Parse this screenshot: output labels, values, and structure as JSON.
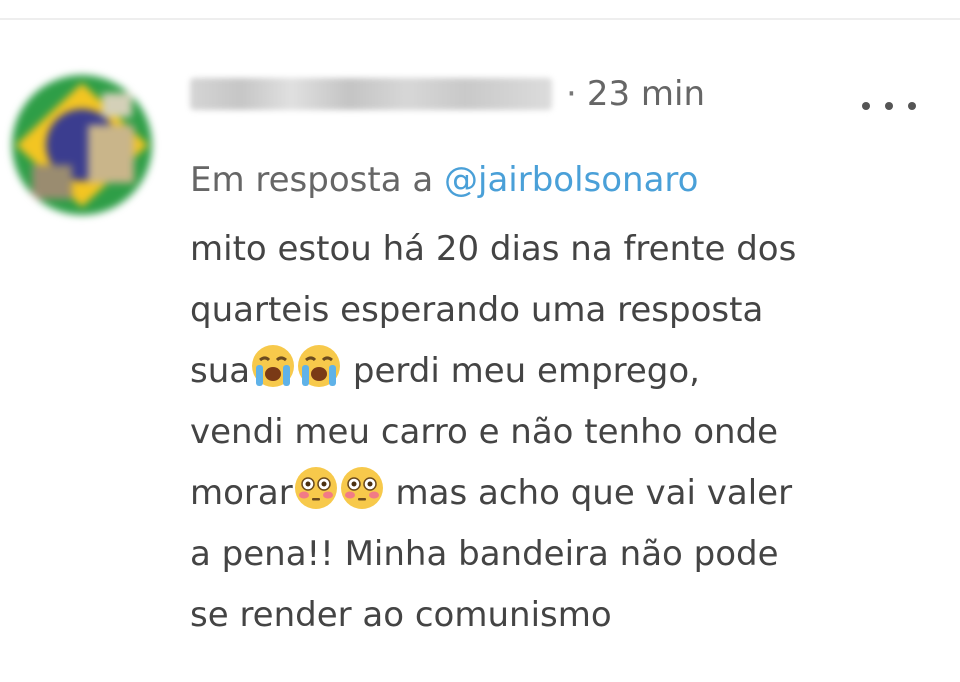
{
  "post": {
    "time": "23 min",
    "more_label": "•••",
    "reply_prefix": "Em resposta a ",
    "reply_mention": "@jairbolsonaro",
    "body": {
      "line1": "mito estou há 20 dias na frente dos",
      "line2": "quarteis esperando uma resposta",
      "line3_a": "sua",
      "line3_b": " perdi meu emprego,",
      "line4": "vendi meu carro e não tenho onde",
      "line5_a": "morar",
      "line5_b": " mas acho que vai valer",
      "line6": "a pena!! Minha bandeira não pode",
      "line7": "se render ao comunismo"
    },
    "emoji_names": [
      "loudly-crying-face",
      "loudly-crying-face",
      "flushed-face",
      "flushed-face"
    ]
  },
  "colors": {
    "mention": "#4aa0d8",
    "text": "#444444",
    "meta": "#666666",
    "avatar_green": "#2e9e47",
    "avatar_yellow": "#f3c522",
    "avatar_blue": "#3b3d8f"
  }
}
